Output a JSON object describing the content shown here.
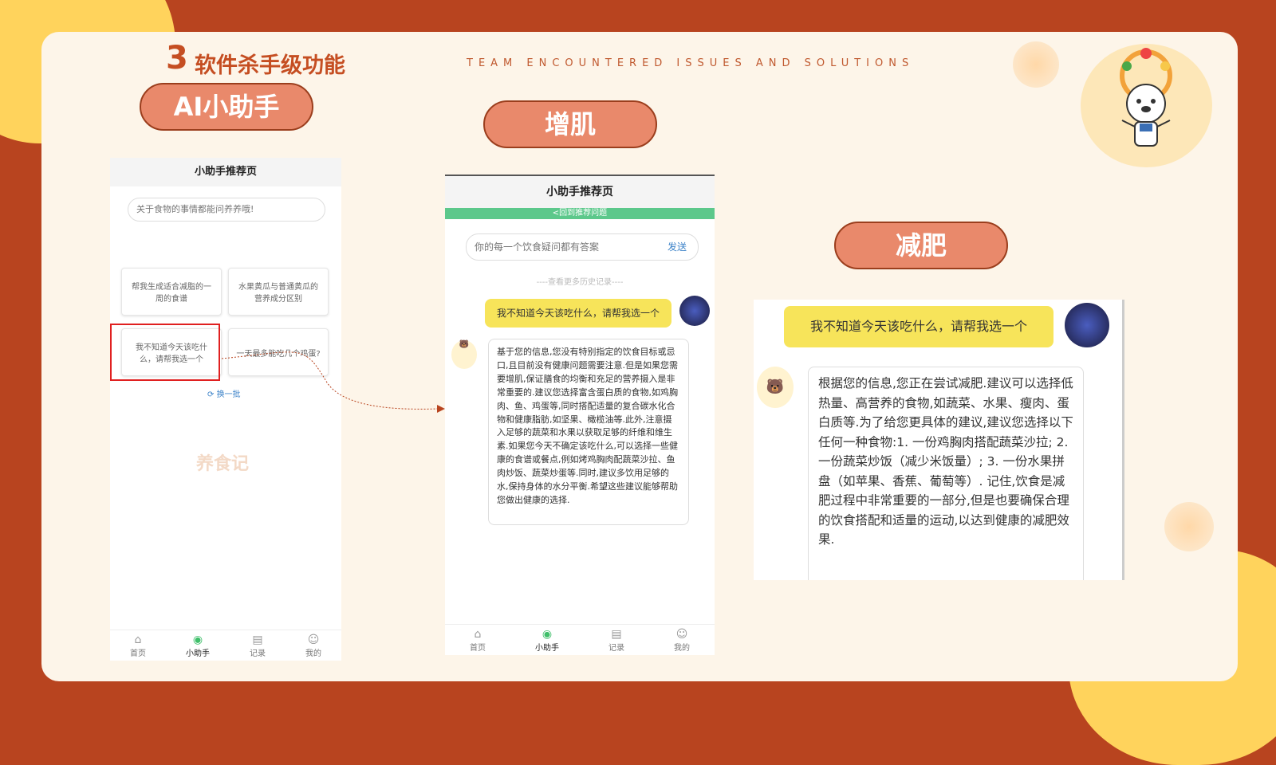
{
  "slide": {
    "number": "3",
    "title": "软件杀手级功能",
    "tagline": "TEAM ENCOUNTERED ISSUES AND SOLUTIONS"
  },
  "pills": {
    "ai": "AI小助手",
    "muscle": "增肌",
    "lose": "减肥"
  },
  "phone1": {
    "header": "小助手推荐页",
    "search_placeholder": "关于食物的事情都能问养养哦!",
    "cards": [
      "帮我生成适合减脂的一周的食谱",
      "水果黄瓜与普通黄瓜的营养成分区别",
      "我不知道今天该吃什么，请帮我选一个",
      "一天最多能吃几个鸡蛋?"
    ],
    "refresh": "换一批",
    "watermark": "养食记"
  },
  "phone2": {
    "header": "小助手推荐页",
    "back_link": "<回到推荐问题",
    "input_placeholder": "你的每一个饮食疑问都有答案",
    "send": "发送",
    "history": "----查看更多历史记录----",
    "user_msg": "我不知道今天该吃什么，请帮我选一个",
    "bot_reply": "基于您的信息,您没有特别指定的饮食目标或忌口,且目前没有健康问题需要注意.但是如果您需要增肌,保证膳食的均衡和充足的营养摄入是非常重要的.建议您选择富含蛋白质的食物,如鸡胸肉、鱼、鸡蛋等,同时搭配适量的复合碳水化合物和健康脂肪,如坚果、橄榄油等.此外,注意摄入足够的蔬菜和水果以获取足够的纤维和维生素.如果您今天不确定该吃什么,可以选择一些健康的食谱或餐点,例如烤鸡胸肉配蔬菜沙拉、鱼肉炒饭、蔬菜炒蛋等.同时,建议多饮用足够的水,保持身体的水分平衡.希望这些建议能够帮助您做出健康的选择."
  },
  "panel3": {
    "user_msg": "我不知道今天该吃什么，请帮我选一个",
    "bot_reply": "根据您的信息,您正在尝试减肥.建议可以选择低热量、高营养的食物,如蔬菜、水果、瘦肉、蛋白质等.为了给您更具体的建议,建议您选择以下任何一种食物:1. 一份鸡胸肉搭配蔬菜沙拉; 2. 一份蔬菜炒饭（减少米饭量）; 3. 一份水果拼盘（如苹果、香蕉、葡萄等）. 记住,饮食是减肥过程中非常重要的一部分,但是也要确保合理的饮食搭配和适量的运动,以达到健康的减肥效果."
  },
  "tabs": [
    "首页",
    "小助手",
    "记录",
    "我的"
  ],
  "colors": {
    "accent": "#c54e22",
    "pill": "#e9896b",
    "green": "#3fbf6a",
    "bubble": "#f7e45a"
  }
}
